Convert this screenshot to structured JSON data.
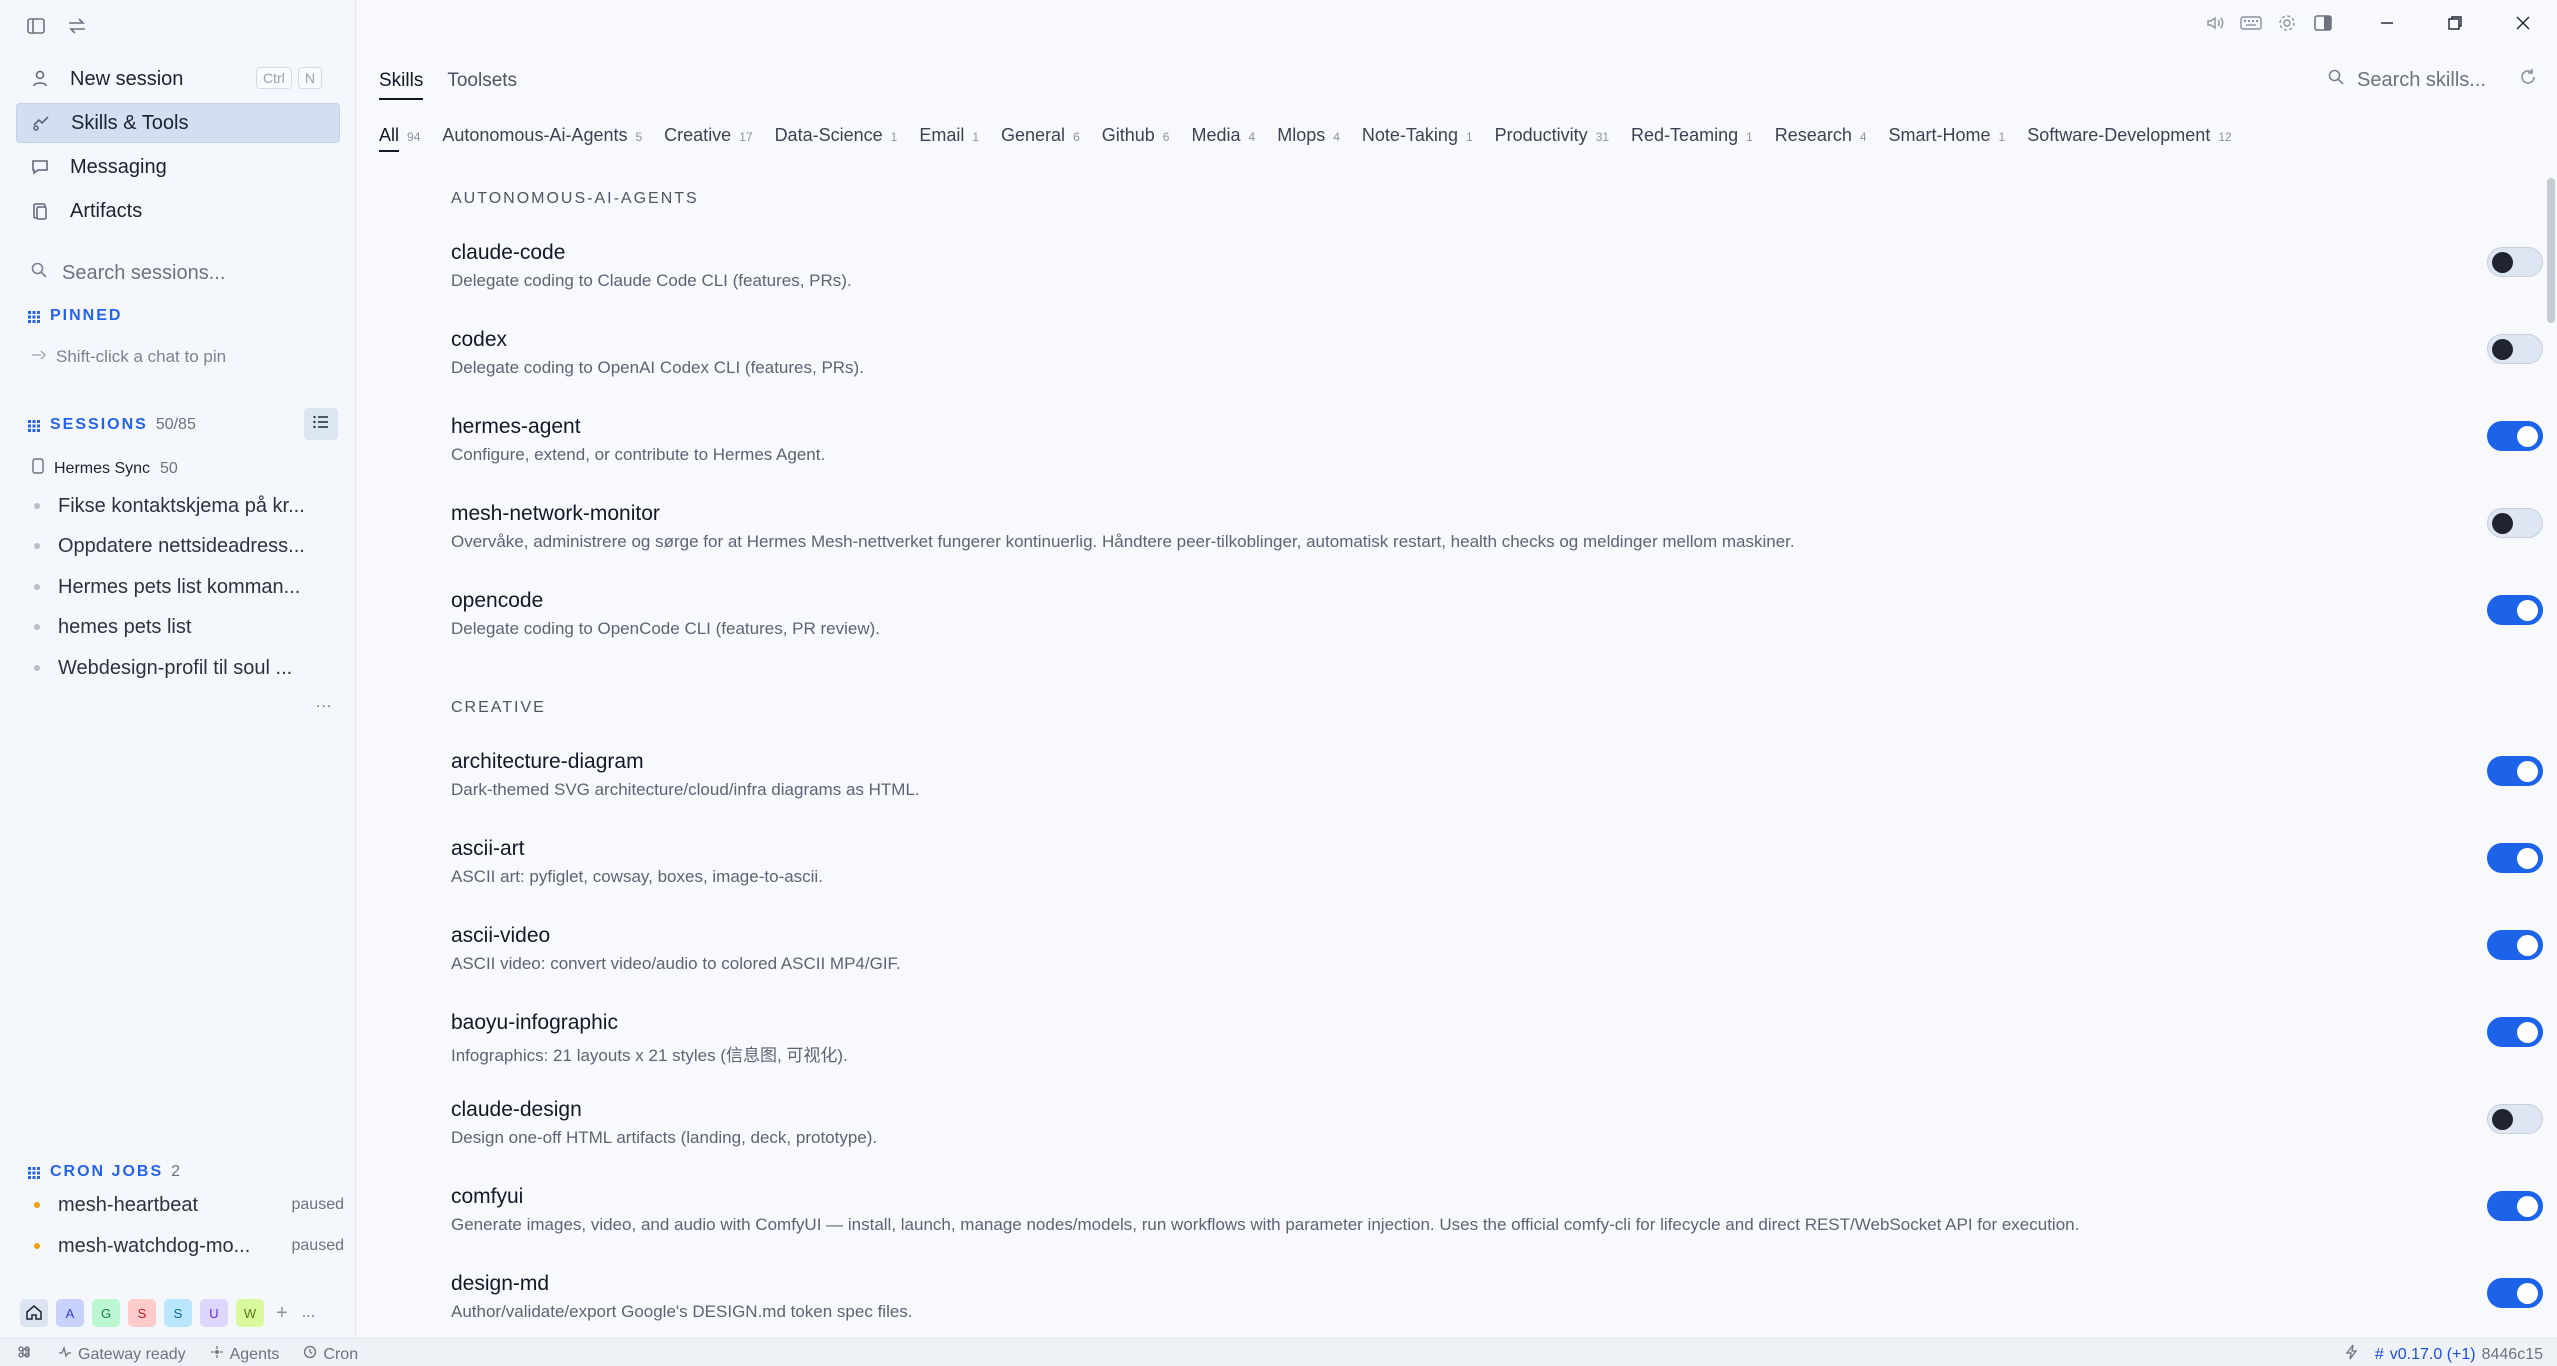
{
  "sidebar": {
    "nav": [
      {
        "label": "New session",
        "icon": "new-session-icon"
      },
      {
        "label": "Skills & Tools",
        "icon": "skills-tools-icon"
      },
      {
        "label": "Messaging",
        "icon": "message-icon"
      },
      {
        "label": "Artifacts",
        "icon": "artifacts-icon"
      }
    ],
    "shortcut": {
      "key1": "Ctrl",
      "key2": "N"
    },
    "search_placeholder": "Search sessions...",
    "pinned": {
      "title": "PINNED",
      "hint": "Shift-click a chat to pin"
    },
    "sessions": {
      "title": "SESSIONS",
      "count": "50/85",
      "group": {
        "name": "Hermes Sync",
        "count": "50"
      },
      "items": [
        "Fikse kontaktskjema på kr...",
        "Oppdatere nettsideadress...",
        "Hermes pets list komman...",
        "hemes pets list",
        "Webdesign-profil til soul ..."
      ],
      "more": "..."
    },
    "cron": {
      "title": "CRON JOBS",
      "count": "2",
      "items": [
        {
          "name": "mesh-heartbeat",
          "state": "paused"
        },
        {
          "name": "mesh-watchdog-mo...",
          "state": "paused"
        }
      ]
    },
    "profiles": [
      {
        "letter": "A",
        "color": "#c7d2fe"
      },
      {
        "letter": "G",
        "color": "#bbf7d0"
      },
      {
        "letter": "S",
        "color": "#fecaca"
      },
      {
        "letter": "S",
        "color": "#bae6fd"
      },
      {
        "letter": "U",
        "color": "#ddd6fe"
      },
      {
        "letter": "W",
        "color": "#d9f99d"
      }
    ],
    "profile_add": "+",
    "profile_more": "..."
  },
  "main": {
    "tabs": [
      "Skills",
      "Toolsets"
    ],
    "search_placeholder": "Search skills...",
    "filters": [
      {
        "label": "All",
        "count": "94"
      },
      {
        "label": "Autonomous-Ai-Agents",
        "count": "5"
      },
      {
        "label": "Creative",
        "count": "17"
      },
      {
        "label": "Data-Science",
        "count": "1"
      },
      {
        "label": "Email",
        "count": "1"
      },
      {
        "label": "General",
        "count": "6"
      },
      {
        "label": "Github",
        "count": "6"
      },
      {
        "label": "Media",
        "count": "4"
      },
      {
        "label": "Mlops",
        "count": "4"
      },
      {
        "label": "Note-Taking",
        "count": "1"
      },
      {
        "label": "Productivity",
        "count": "31"
      },
      {
        "label": "Red-Teaming",
        "count": "1"
      },
      {
        "label": "Research",
        "count": "4"
      },
      {
        "label": "Smart-Home",
        "count": "1"
      },
      {
        "label": "Software-Development",
        "count": "12"
      }
    ],
    "categories": [
      {
        "title": "AUTONOMOUS-AI-AGENTS",
        "skills": [
          {
            "name": "claude-code",
            "desc": "Delegate coding to Claude Code CLI (features, PRs).",
            "enabled": false
          },
          {
            "name": "codex",
            "desc": "Delegate coding to OpenAI Codex CLI (features, PRs).",
            "enabled": false
          },
          {
            "name": "hermes-agent",
            "desc": "Configure, extend, or contribute to Hermes Agent.",
            "enabled": true
          },
          {
            "name": "mesh-network-monitor",
            "desc": "Overvåke, administrere og sørge for at Hermes Mesh-nettverket fungerer kontinuerlig. Håndtere peer-tilkoblinger, automatisk restart, health checks og meldinger mellom maskiner.",
            "enabled": false
          },
          {
            "name": "opencode",
            "desc": "Delegate coding to OpenCode CLI (features, PR review).",
            "enabled": true
          }
        ]
      },
      {
        "title": "CREATIVE",
        "skills": [
          {
            "name": "architecture-diagram",
            "desc": "Dark-themed SVG architecture/cloud/infra diagrams as HTML.",
            "enabled": true
          },
          {
            "name": "ascii-art",
            "desc": "ASCII art: pyfiglet, cowsay, boxes, image-to-ascii.",
            "enabled": true
          },
          {
            "name": "ascii-video",
            "desc": "ASCII video: convert video/audio to colored ASCII MP4/GIF.",
            "enabled": true
          },
          {
            "name": "baoyu-infographic",
            "desc": "Infographics: 21 layouts x 21 styles (信息图, 可视化).",
            "enabled": true
          },
          {
            "name": "claude-design",
            "desc": "Design one-off HTML artifacts (landing, deck, prototype).",
            "enabled": false
          },
          {
            "name": "comfyui",
            "desc": "Generate images, video, and audio with ComfyUI — install, launch, manage nodes/models, run workflows with parameter injection. Uses the official comfy-cli for lifecycle and direct REST/WebSocket API for execution.",
            "enabled": true
          },
          {
            "name": "design-md",
            "desc": "Author/validate/export Google's DESIGN.md token spec files.",
            "enabled": true
          }
        ]
      }
    ]
  },
  "statusbar": {
    "gateway": "Gateway ready",
    "agents": "Agents",
    "cron": "Cron",
    "version": "v0.17.0 (+1)",
    "hash": "8446c15"
  },
  "colors": {
    "accent": "#1d63ea",
    "active_nav": "#d3dff0",
    "pinned_head": "#2563eb",
    "cron_dot": "#f59e0b"
  }
}
